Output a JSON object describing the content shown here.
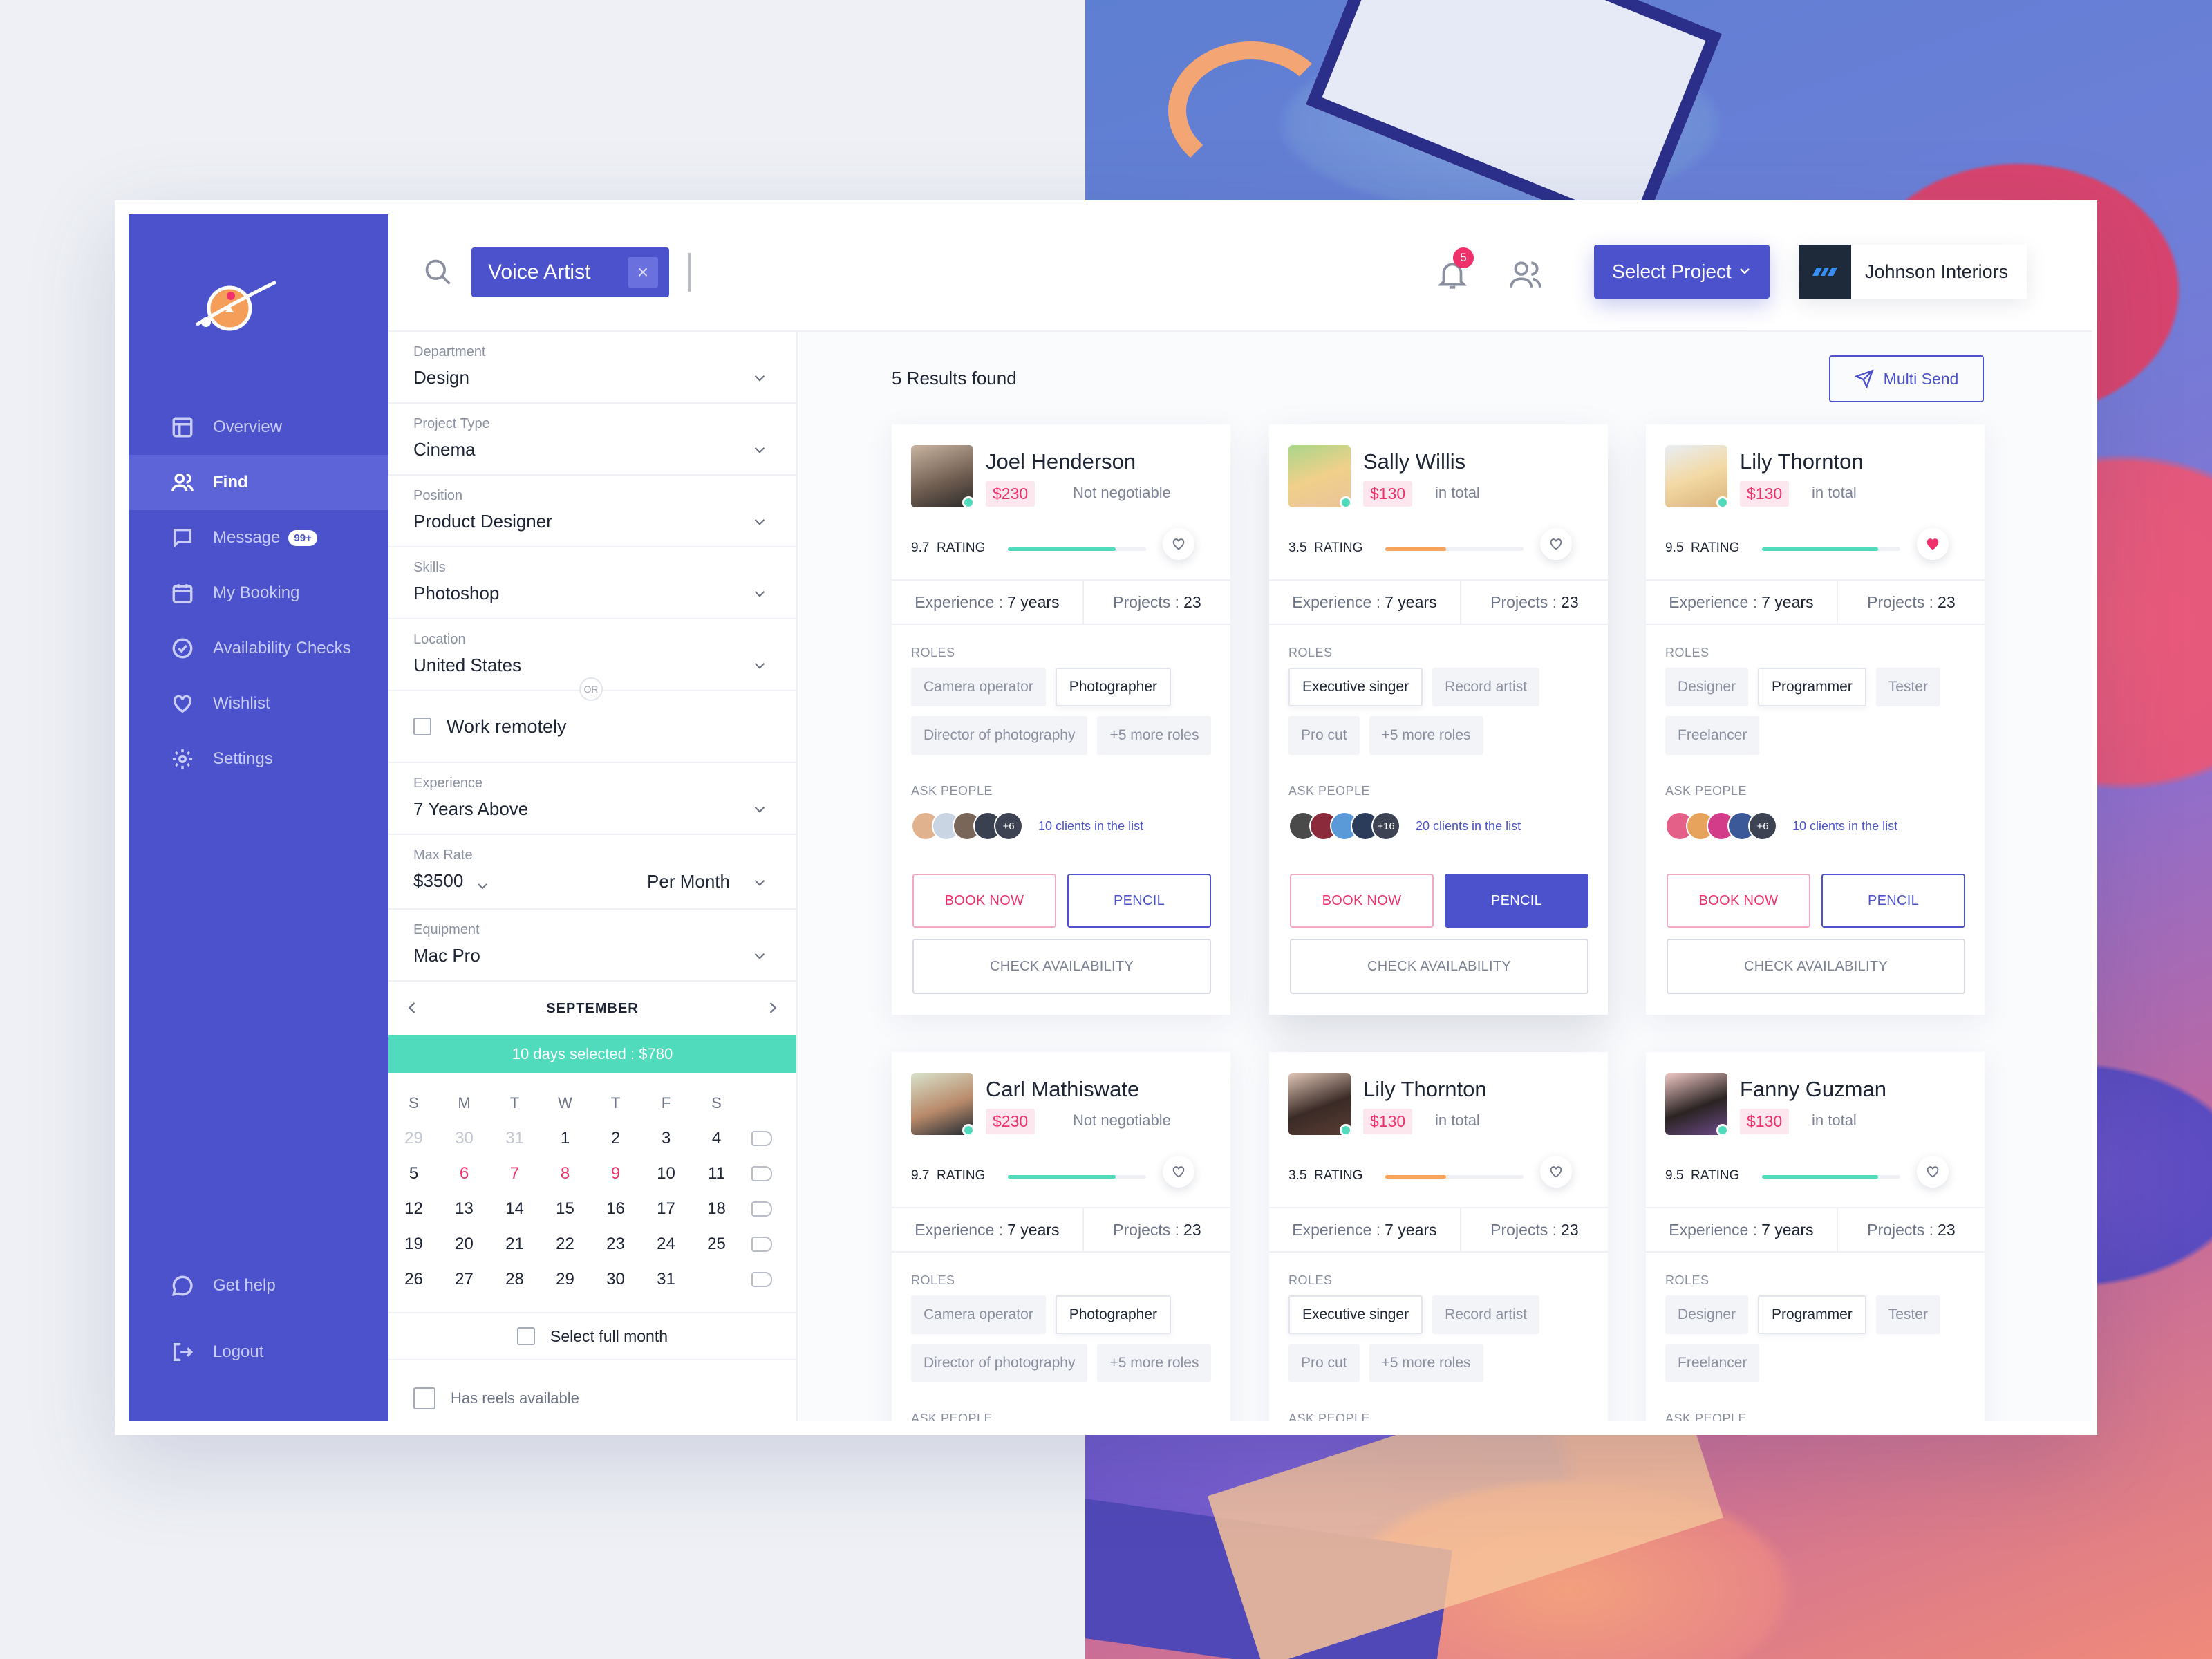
{
  "sidebar": {
    "items": [
      {
        "label": "Overview",
        "icon": "layout-icon"
      },
      {
        "label": "Find",
        "icon": "users-icon",
        "active": true
      },
      {
        "label": "Message",
        "icon": "chat-icon",
        "badge": "99+"
      },
      {
        "label": "My Booking",
        "icon": "calendar-icon"
      },
      {
        "label": "Availability Checks",
        "icon": "check-circle-icon"
      },
      {
        "label": "Wishlist",
        "icon": "heart-icon"
      },
      {
        "label": "Settings",
        "icon": "gear-icon"
      }
    ],
    "bottom": [
      {
        "label": "Get help",
        "icon": "help-chat-icon"
      },
      {
        "label": "Logout",
        "icon": "logout-icon"
      }
    ]
  },
  "topbar": {
    "search_chip": "Voice Artist",
    "notification_count": "5",
    "select_project": "Select Project",
    "company": "Johnson Interiors"
  },
  "filters": {
    "department": {
      "label": "Department",
      "value": "Design"
    },
    "project_type": {
      "label": "Project Type",
      "value": "Cinema"
    },
    "position": {
      "label": "Position",
      "value": "Product Designer"
    },
    "skills": {
      "label": "Skills",
      "value": "Photoshop"
    },
    "location": {
      "label": "Location",
      "value": "United States"
    },
    "or": "OR",
    "work_remotely": "Work remotely",
    "experience": {
      "label": "Experience",
      "value": "7 Years Above"
    },
    "max_rate": {
      "label": "Max Rate",
      "value": "$3500",
      "period": "Per Month"
    },
    "equipment": {
      "label": "Equipment",
      "value": "Mac Pro"
    },
    "calendar": {
      "month": "SEPTEMBER",
      "selected": "10 days selected : $780",
      "weekdays": [
        "S",
        "M",
        "T",
        "W",
        "T",
        "F",
        "S"
      ],
      "weeks": [
        [
          "29",
          "30",
          "31",
          "1",
          "2",
          "3",
          "4"
        ],
        [
          "5",
          "6",
          "7",
          "8",
          "9",
          "10",
          "11"
        ],
        [
          "12",
          "13",
          "14",
          "15",
          "16",
          "17",
          "18"
        ],
        [
          "19",
          "20",
          "21",
          "22",
          "23",
          "24",
          "25"
        ],
        [
          "26",
          "27",
          "28",
          "29",
          "30",
          "31",
          ""
        ]
      ]
    },
    "select_full_month": "Select full month",
    "has_reels": "Has reels available"
  },
  "results": {
    "count": "5 Results found",
    "multi_send": "Multi Send",
    "labels": {
      "rating": "RATING",
      "experience": "Experience :",
      "projects": "Projects :",
      "roles": "ROLES",
      "ask": "ASK PEOPLE",
      "book": "BOOK NOW",
      "pencil": "PENCIL",
      "check": "CHECK AVAILABILITY"
    },
    "cards": [
      {
        "name": "Joel Henderson",
        "price": "$230",
        "note": "Not negotiable",
        "rating": "9.7",
        "exp": "7 years",
        "projects": "23",
        "roles": [
          "Camera operator",
          "Photographer",
          "Director of photography",
          "+5 more roles"
        ],
        "active_role": 1,
        "ask_more": "+6",
        "clients": "10 clients in the list",
        "wish": false,
        "pencil_filled": false,
        "bar_color": "#4fdbbc",
        "rating_fraction": 0.78
      },
      {
        "name": "Sally Willis",
        "price": "$130",
        "note": "in total",
        "rating": "3.5",
        "exp": "7 years",
        "projects": "23",
        "roles": [
          "Executive singer",
          "Record artist",
          "Pro cut",
          "+5 more roles"
        ],
        "active_role": 0,
        "ask_more": "+16",
        "clients": "20 clients in the list",
        "wish": false,
        "pencil_filled": true,
        "bar_color": "#f7a35c",
        "rating_fraction": 0.44
      },
      {
        "name": "Lily Thornton",
        "price": "$130",
        "note": "in total",
        "rating": "9.5",
        "exp": "7 years",
        "projects": "23",
        "roles": [
          "Designer",
          "Programmer",
          "Tester",
          "Freelancer"
        ],
        "active_role": 1,
        "ask_more": "+6",
        "clients": "10 clients in the list",
        "wish": true,
        "pencil_filled": false,
        "bar_color": "#4fdbbc",
        "rating_fraction": 0.84
      },
      {
        "name": "Carl Mathiswate",
        "price": "$230",
        "note": "Not negotiable",
        "rating": "9.7",
        "exp": "7 years",
        "projects": "23",
        "roles": [
          "Camera operator",
          "Photographer",
          "Director of photography",
          "+5 more roles"
        ],
        "active_role": 1,
        "wish": false,
        "bar_color": "#4fdbbc",
        "rating_fraction": 0.78
      },
      {
        "name": "Lily Thornton",
        "price": "$130",
        "note": "in total",
        "rating": "3.5",
        "exp": "7 years",
        "projects": "23",
        "roles": [
          "Executive singer",
          "Record artist",
          "Pro cut",
          "+5 more roles"
        ],
        "active_role": 0,
        "wish": false,
        "bar_color": "#f7a35c",
        "rating_fraction": 0.44
      },
      {
        "name": "Fanny Guzman",
        "price": "$130",
        "note": "in total",
        "rating": "9.5",
        "exp": "7 years",
        "projects": "23",
        "roles": [
          "Designer",
          "Programmer",
          "Tester",
          "Freelancer"
        ],
        "active_role": 1,
        "wish": false,
        "bar_color": "#4fdbbc",
        "rating_fraction": 0.84
      }
    ]
  }
}
